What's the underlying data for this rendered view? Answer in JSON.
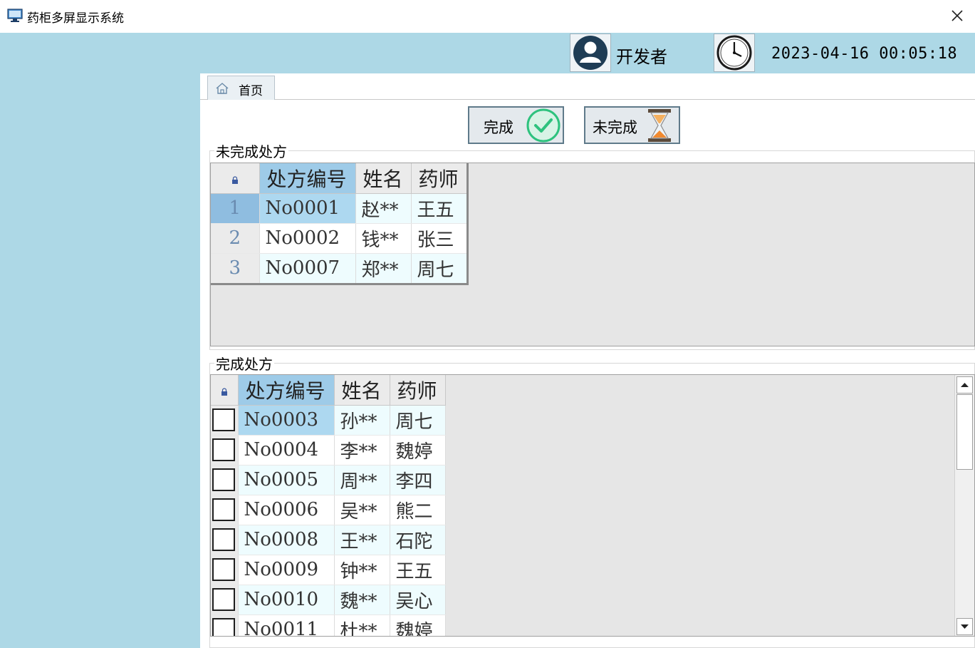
{
  "window": {
    "title": "药柜多屏显示系统"
  },
  "header": {
    "user_name": "开发者",
    "datetime": "2023-04-16 00:05:18"
  },
  "tabs": [
    {
      "label": "首页"
    }
  ],
  "toolbar": {
    "complete_label": "完成",
    "incomplete_label": "未完成"
  },
  "incomplete_section": {
    "title": "未完成处方",
    "columns": [
      "处方编号",
      "姓名",
      "药师"
    ],
    "rows": [
      {
        "num": "1",
        "id": "No0001",
        "name": "赵**",
        "pharmacist": "王五"
      },
      {
        "num": "2",
        "id": "No0002",
        "name": "钱**",
        "pharmacist": "张三"
      },
      {
        "num": "3",
        "id": "No0007",
        "name": "郑**",
        "pharmacist": "周七"
      }
    ]
  },
  "complete_section": {
    "title": "完成处方",
    "columns": [
      "处方编号",
      "姓名",
      "药师"
    ],
    "rows": [
      {
        "id": "No0003",
        "name": "孙**",
        "pharmacist": "周七"
      },
      {
        "id": "No0004",
        "name": "李**",
        "pharmacist": "魏婷"
      },
      {
        "id": "No0005",
        "name": "周**",
        "pharmacist": "李四"
      },
      {
        "id": "No0006",
        "name": "吴**",
        "pharmacist": "熊二"
      },
      {
        "id": "No0008",
        "name": "王**",
        "pharmacist": "石陀"
      },
      {
        "id": "No0009",
        "name": "钟**",
        "pharmacist": "王五"
      },
      {
        "id": "No0010",
        "name": "魏**",
        "pharmacist": "吴心"
      },
      {
        "id": "No0011",
        "name": "杜**",
        "pharmacist": "魏婷"
      }
    ]
  },
  "icons": {
    "app": "monitor-icon",
    "close": "close-icon",
    "user": "user-avatar-icon",
    "clock": "clock-icon",
    "home": "home-icon",
    "check": "check-circle-icon",
    "hourglass": "hourglass-icon",
    "lock": "lock-icon"
  },
  "colors": {
    "header_bg": "#add8e6",
    "selected_cell": "#add8f0",
    "sorted_header": "#9ecbe8",
    "check_green": "#2ec27e"
  }
}
